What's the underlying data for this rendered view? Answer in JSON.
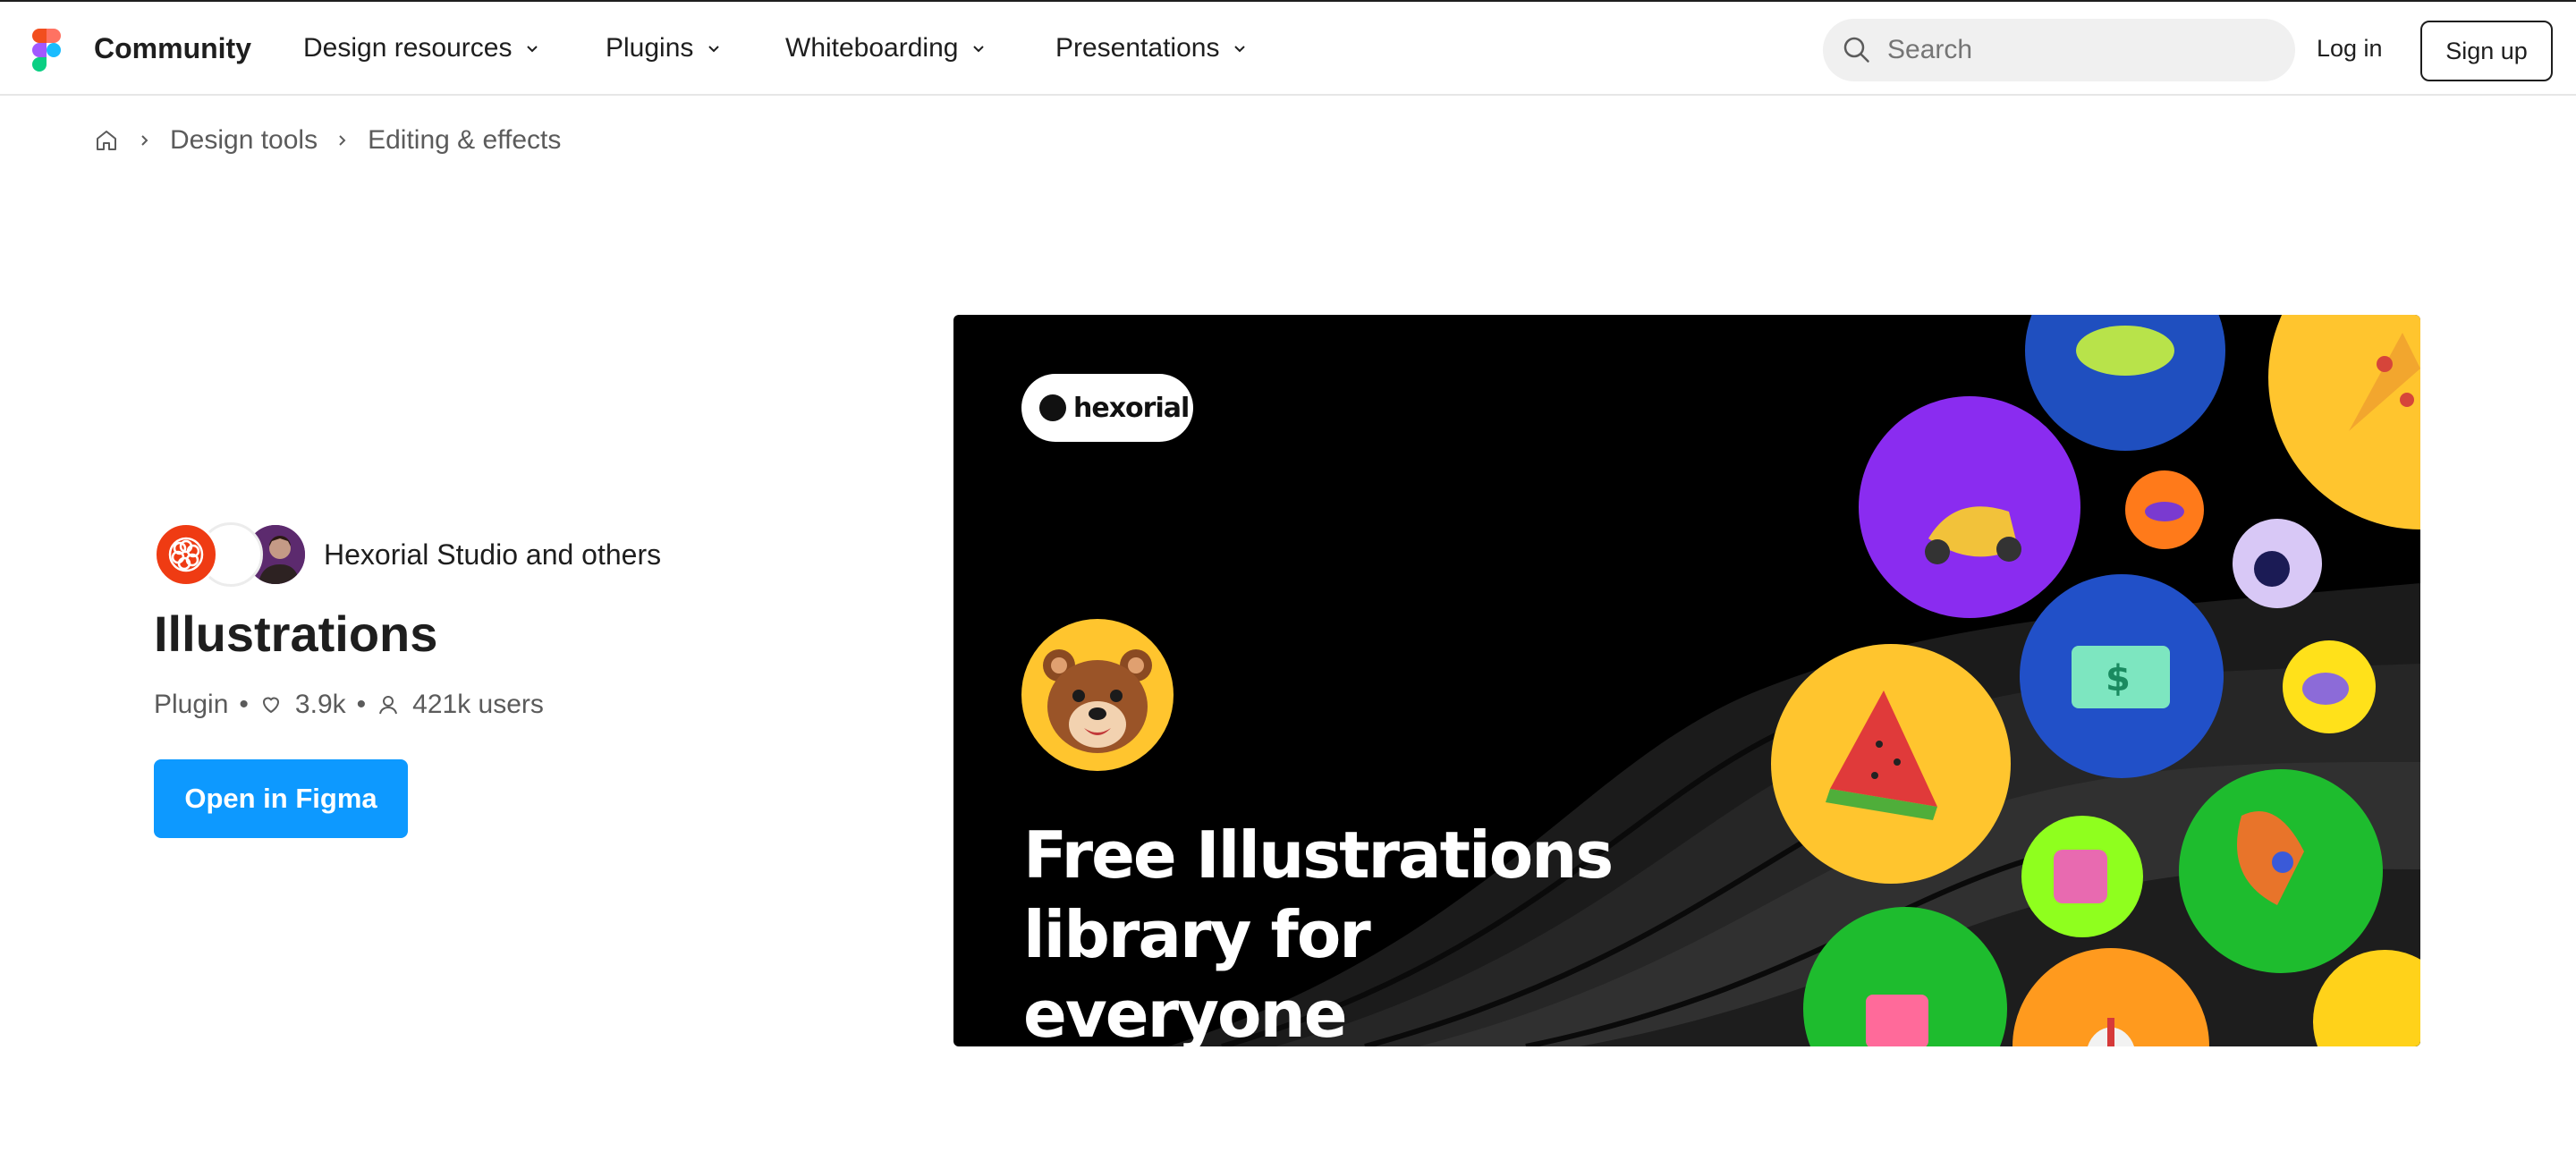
{
  "header": {
    "brand": "Community",
    "nav": [
      "Design resources",
      "Plugins",
      "Whiteboarding",
      "Presentations"
    ],
    "search_placeholder": "Search",
    "login": "Log in",
    "signup": "Sign up"
  },
  "breadcrumb": {
    "items": [
      "Design tools",
      "Editing & effects"
    ]
  },
  "plugin": {
    "author": "Hexorial Studio and others",
    "title": "Illustrations",
    "type": "Plugin",
    "likes": "3.9k",
    "users": "421k users",
    "open_button": "Open in Figma"
  },
  "hero": {
    "badge": "hexorial",
    "headline_line1": "Free Illustrations",
    "headline_line2": "library for everyone"
  },
  "colors": {
    "accent": "#0d99ff",
    "hero_bg": "#000000",
    "text": "#1e1e1e",
    "muted": "#5b5b5b"
  }
}
